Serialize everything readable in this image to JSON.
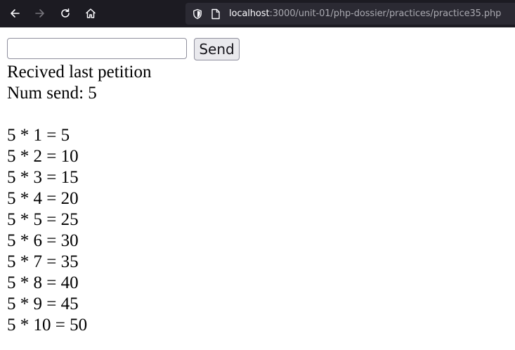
{
  "browser": {
    "url_host": "localhost",
    "url_rest": ":3000/unit-01/php-dossier/practices/practice35.php"
  },
  "form": {
    "input_value": "",
    "send_label": "Send"
  },
  "output": {
    "status": "Recived last petition",
    "num_sent": "Num send: 5",
    "table": [
      "5 * 1 = 5",
      "5 * 2 = 10",
      "5 * 3 = 15",
      "5 * 4 = 20",
      "5 * 5 = 25",
      "5 * 6 = 30",
      "5 * 7 = 35",
      "5 * 8 = 40",
      "5 * 9 = 45",
      "5 * 10 = 50"
    ]
  },
  "icons": {
    "back": "back-arrow-icon",
    "forward": "forward-arrow-icon",
    "reload": "reload-icon",
    "home": "home-icon",
    "tracking": "shield-icon",
    "page": "page-icon"
  },
  "colors": {
    "toolbar_bg": "#1c1b22",
    "urlbar_bg": "#2b2a33",
    "button_bg": "#e9e9ed"
  }
}
